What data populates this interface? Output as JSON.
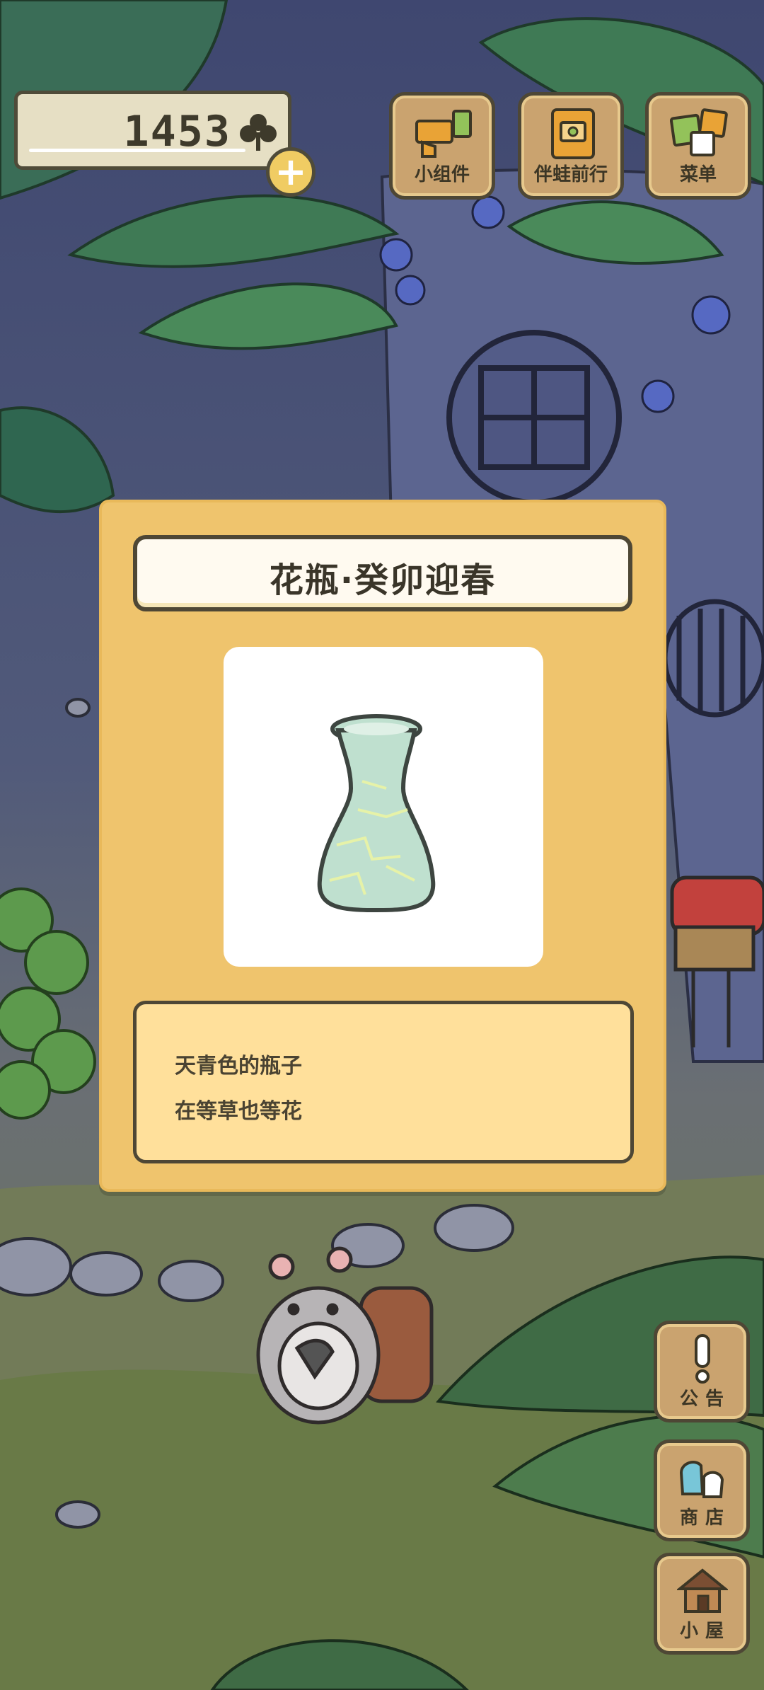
{
  "currency": {
    "amount": "1453",
    "icon": "clover-icon",
    "add_icon": "plus-icon"
  },
  "toolbar": {
    "widgets_label": "小组件",
    "travel_label": "伴蛙前行",
    "menu_label": "菜单"
  },
  "sidebar": {
    "notice_label": "公告",
    "shop_label": "商店",
    "house_label": "小屋"
  },
  "item_dialog": {
    "title": "花瓶·癸卯迎春",
    "item_icon": "vase-icon",
    "description": [
      "天青色的瓶子",
      "在等草也等花"
    ]
  },
  "colors": {
    "dialog_bg": "#efc46d",
    "title_bg": "#fffaf0",
    "desc_bg": "#ffe09b",
    "outline": "#4e4735",
    "vase": "#bfe0cf"
  }
}
